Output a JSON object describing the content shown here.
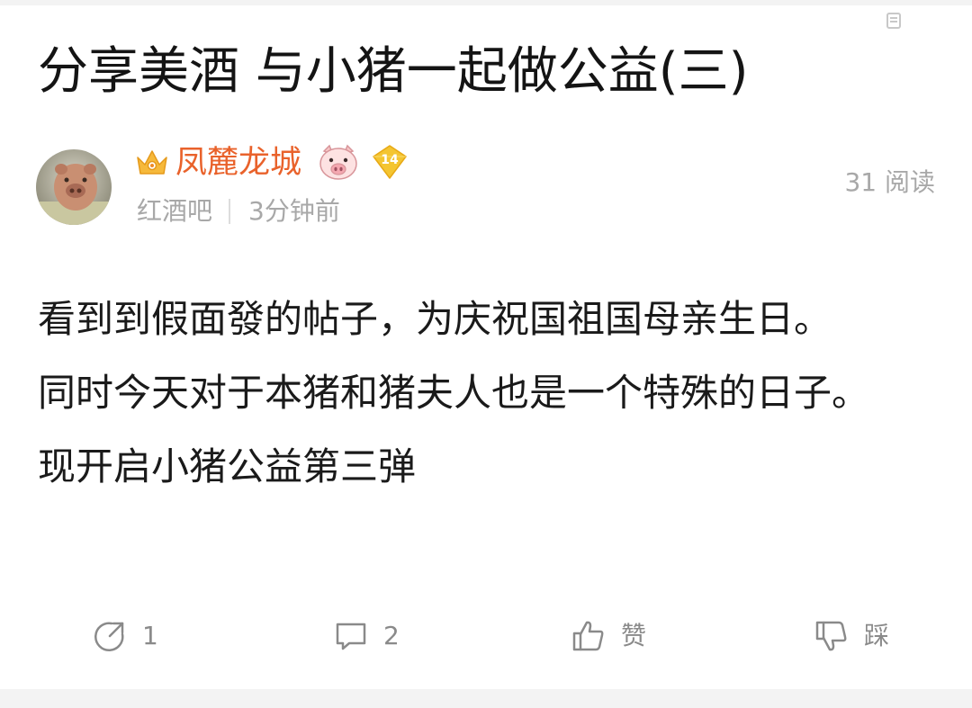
{
  "post": {
    "title": "分享美酒 与小猪一起做公益(三)",
    "author": {
      "name": "凤麓龙城",
      "level": "14",
      "name_color": "#e9622b"
    },
    "forum": "红酒吧",
    "time": "3分钟前",
    "read_count": "31 阅读",
    "body": [
      "看到到假面發的帖子，为庆祝国祖国母亲生日。",
      "同时今天对于本猪和猪夫人也是一个特殊的日子。",
      "现开启小猪公益第三弹"
    ]
  },
  "actions": {
    "share": {
      "icon": "share-icon",
      "label": "1"
    },
    "comment": {
      "icon": "comment-icon",
      "label": "2"
    },
    "like": {
      "icon": "thumbs-up-icon",
      "label": "赞"
    },
    "dislike": {
      "icon": "thumbs-down-icon",
      "label": "踩"
    }
  },
  "colors": {
    "text_primary": "#141414",
    "text_secondary": "#a8a8a8",
    "icon_gray": "#8a8a8a",
    "badge_gold": "#f4c531"
  }
}
